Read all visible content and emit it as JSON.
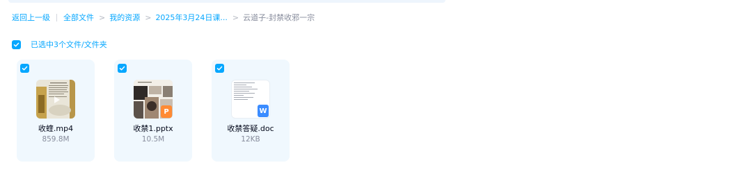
{
  "breadcrumb": {
    "back_label": "返回上一级",
    "items": [
      "全部文件",
      "我的资源",
      "2025年3月24日课..."
    ],
    "current": "云道子-封禁收邪一宗"
  },
  "selection": {
    "text": "已选中3个文件/文件夹",
    "checked": true
  },
  "files": [
    {
      "name": "收蝰.mp4",
      "size": "859.8M",
      "type": "video"
    },
    {
      "name": "收禁1.pptx",
      "size": "10.5M",
      "type": "pptx",
      "badge": "P"
    },
    {
      "name": "收禁答疑.doc",
      "size": "12KB",
      "type": "doc",
      "badge": "W"
    }
  ],
  "colors": {
    "accent": "#06a7ff",
    "card_bg": "#f0f8fe",
    "ppt_badge": "#ff8a34",
    "doc_badge": "#3b8cff"
  }
}
